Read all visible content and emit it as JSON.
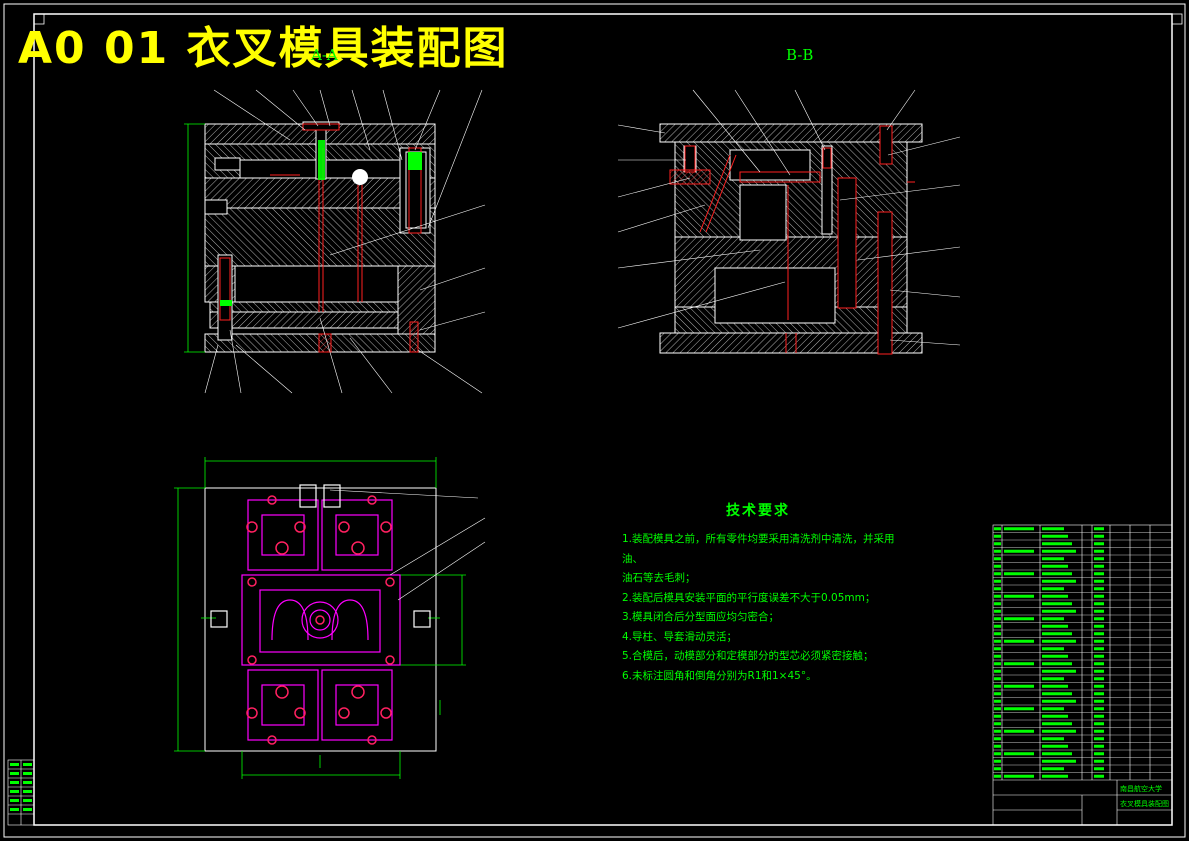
{
  "title": "A0 01 衣叉模具装配图",
  "views": {
    "section_aa": "A-A",
    "section_bb": "B-B"
  },
  "technical_requirements": {
    "heading": "技术要求",
    "items": [
      "1.装配模具之前，所有零件均要采用清洗剂中清洗，并采用油、",
      "油石等去毛刺；",
      "2.装配后模具安装平面的平行度误差不大于0.05mm；",
      "3.模具闭合后分型面应均匀密合；",
      "4.导柱、导套滑动灵活；",
      "5.合模后，动模部分和定模部分的型芯必须紧密接触；",
      "6.未标注圆角和倒角分别为R1和1×45°。"
    ]
  },
  "title_block": {
    "university": "南昌航空大学",
    "drawing_name": "衣叉模具装配图"
  },
  "colors": {
    "background": "#000000",
    "outline": "#ffffff",
    "section_line": "#ff0000",
    "dimension": "#00ff00",
    "plan_view": "#ff00ff",
    "title_text": "#ffff00"
  }
}
